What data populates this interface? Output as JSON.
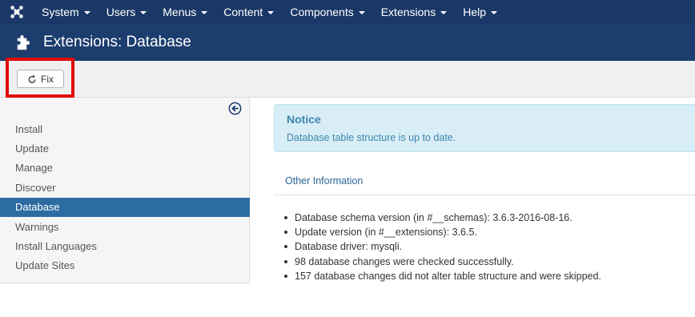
{
  "navbar": {
    "logo_icon": "joomla-logo-icon",
    "menus": [
      "System",
      "Users",
      "Menus",
      "Content",
      "Components",
      "Extensions",
      "Help"
    ]
  },
  "header": {
    "icon": "puzzle-icon",
    "title": "Extensions: Database"
  },
  "toolbar": {
    "fix_label": "Fix",
    "fix_icon": "refresh-icon",
    "highlight_color": "#e20a0a"
  },
  "sidebar": {
    "collapse_icon": "arrow-circle-left-icon",
    "items": [
      {
        "label": "Install",
        "active": false
      },
      {
        "label": "Update",
        "active": false
      },
      {
        "label": "Manage",
        "active": false
      },
      {
        "label": "Discover",
        "active": false
      },
      {
        "label": "Database",
        "active": true
      },
      {
        "label": "Warnings",
        "active": false
      },
      {
        "label": "Install Languages",
        "active": false
      },
      {
        "label": "Update Sites",
        "active": false
      }
    ]
  },
  "notice": {
    "heading": "Notice",
    "message": "Database table structure is up to date."
  },
  "tabs": {
    "other_information": "Other Information"
  },
  "info": [
    "Database schema version (in #__schemas): 3.6.3-2016-08-16.",
    "Update version (in #__extensions): 3.6.5.",
    "Database driver: mysqli.",
    "98 database changes were checked successfully.",
    "157 database changes did not alter table structure and were skipped."
  ],
  "colors": {
    "navbar_bg": "#1a3867",
    "header_bg": "#1c3d6e",
    "active_item_bg": "#2d6ca2",
    "notice_bg": "#d9edf7",
    "notice_text": "#3a87ad"
  }
}
